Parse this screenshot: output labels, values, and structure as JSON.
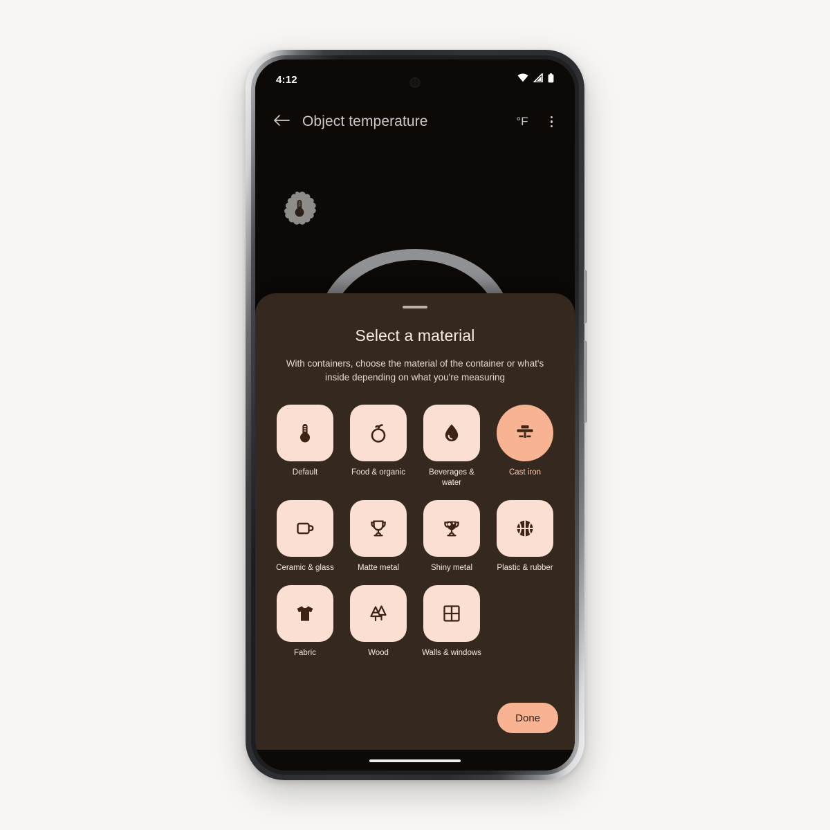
{
  "status_bar": {
    "time": "4:12",
    "icons": [
      "wifi-icon",
      "cellular-signal-icon",
      "battery-icon"
    ]
  },
  "app_bar": {
    "back_icon": "arrow-back-icon",
    "title": "Object temperature",
    "unit_label": "°F",
    "overflow_icon": "more-vert-icon"
  },
  "viewfinder": {
    "badge_icon": "thermometer-badge-icon",
    "gauge_icon": "temperature-gauge-arc"
  },
  "sheet": {
    "handle": "drag-handle",
    "title": "Select a material",
    "subtitle": "With containers, choose the material of the container or what's inside depending on what you're measuring",
    "done_label": "Done"
  },
  "materials": [
    {
      "label": "Default",
      "icon": "thermometer-icon",
      "selected": false
    },
    {
      "label": "Food & organic",
      "icon": "apple-icon",
      "selected": false
    },
    {
      "label": "Beverages & water",
      "icon": "water-drop-icon",
      "selected": false
    },
    {
      "label": "Cast iron",
      "icon": "skillet-icon",
      "selected": true
    },
    {
      "label": "Ceramic & glass",
      "icon": "mug-icon",
      "selected": false
    },
    {
      "label": "Matte metal",
      "icon": "trophy-outline-icon",
      "selected": false
    },
    {
      "label": "Shiny metal",
      "icon": "trophy-shiny-icon",
      "selected": false
    },
    {
      "label": "Plastic & rubber",
      "icon": "basketball-icon",
      "selected": false
    },
    {
      "label": "Fabric",
      "icon": "tshirt-icon",
      "selected": false
    },
    {
      "label": "Wood",
      "icon": "trees-icon",
      "selected": false
    },
    {
      "label": "Walls & windows",
      "icon": "window-grid-icon",
      "selected": false
    }
  ],
  "colors": {
    "page_background": "#f7f6f4",
    "screen_background": "#0c0907",
    "sheet_background": "#35291f",
    "tile_background": "#fadfd2",
    "accent_selected": "#f7b393",
    "accent_button": "#f8b393",
    "icon_dark": "#3b2414",
    "text_primary": "#f6ece6",
    "text_secondary": "#e4d7cf",
    "gauge_arc": "#8f9194"
  }
}
